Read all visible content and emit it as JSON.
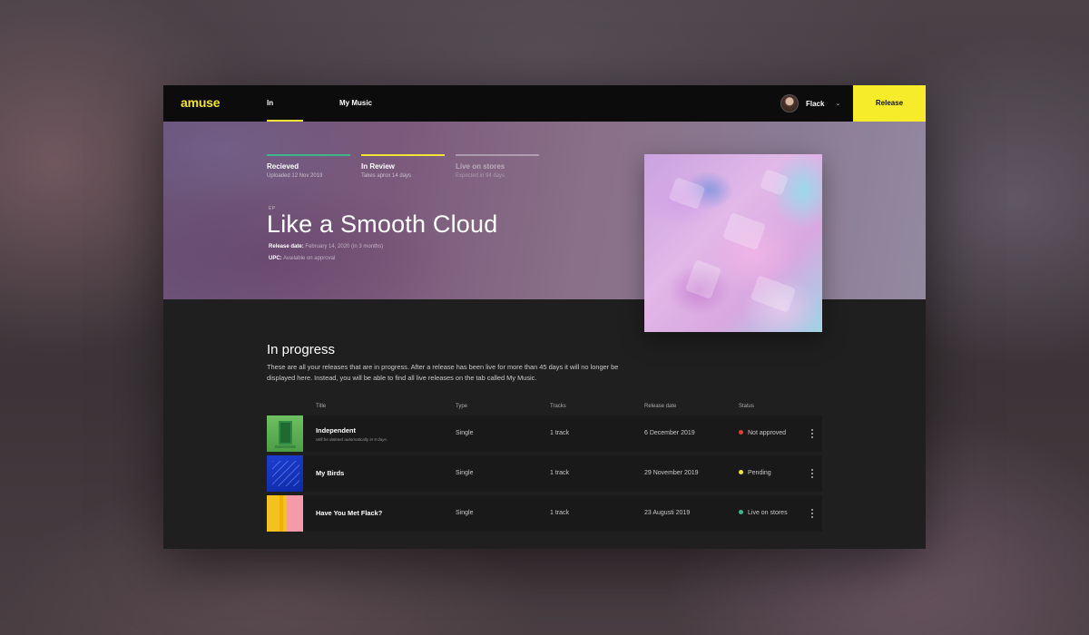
{
  "app": {
    "logo": "amuse",
    "nav": {
      "tabs": [
        {
          "label": "In progress",
          "active": true
        },
        {
          "label": "My Music",
          "active": false
        }
      ]
    },
    "user": {
      "name": "Flack"
    },
    "release_button": "Release",
    "accent_color": "#f2e337"
  },
  "hero": {
    "steps": [
      {
        "label": "Recieved",
        "sub": "Uploaded 12 Nov 2019",
        "color": "#3fb68a"
      },
      {
        "label": "In Review",
        "sub": "Takes aprox 14 days",
        "color": "#f2e337"
      },
      {
        "label": "Live on stores",
        "sub": "Expected in 94 days",
        "color": "#8f8599"
      }
    ],
    "type_tag": "EP",
    "title": "Like a Smooth Cloud",
    "release_date_label": "Release date:",
    "release_date_value": "February 14, 2020 (in 3 months)",
    "upc_label": "UPC:",
    "upc_value": "Available on approval"
  },
  "main": {
    "section_title": "In progress",
    "description": "These are all your releases that are in progress. After a release has been live for more than 45 days it will no longer be displayed here. Instead, you will be able to find all live releases on the tab called My Music.",
    "columns": [
      "Title",
      "Type",
      "Tracks",
      "Release date",
      "Status"
    ],
    "rows": [
      {
        "title": "Independent",
        "subtitle": "Will be deleted automatically in 9 days.",
        "type": "Single",
        "tracks": "1 track",
        "date": "6 December 2019",
        "status": "Not approved",
        "status_color": "#e0403a"
      },
      {
        "title": "My Birds",
        "subtitle": "",
        "type": "Single",
        "tracks": "1 track",
        "date": "29 November 2019",
        "status": "Pending",
        "status_color": "#f2e337"
      },
      {
        "title": "Have You Met Flack?",
        "subtitle": "",
        "type": "Single",
        "tracks": "1 track",
        "date": "23 Augusti 2019",
        "status": "Live on stores",
        "status_color": "#3fb68a"
      }
    ]
  }
}
